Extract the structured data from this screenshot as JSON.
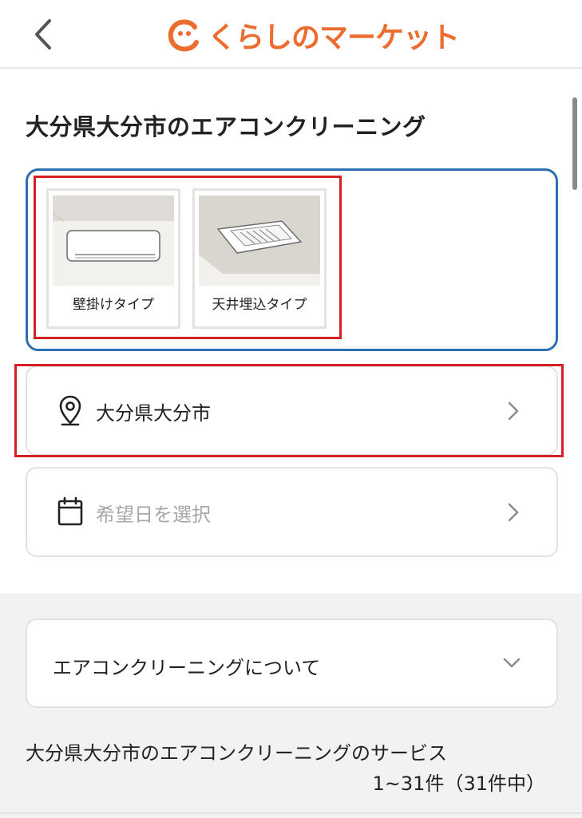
{
  "header": {
    "logo_text": "くらしのマーケット",
    "back_icon": "chevron-left-icon",
    "brand_color": "#ec6d2f"
  },
  "page": {
    "title": "大分県大分市のエアコンクリーニング"
  },
  "types": [
    {
      "label": "壁掛けタイプ",
      "icon": "wall-mounted-ac-icon"
    },
    {
      "label": "天井埋込タイプ",
      "icon": "ceiling-embedded-ac-icon"
    }
  ],
  "location": {
    "value": "大分県大分市",
    "icon": "map-pin-icon"
  },
  "date": {
    "placeholder": "希望日を選択",
    "icon": "calendar-icon"
  },
  "about": {
    "label": "エアコンクリーニングについて",
    "icon": "chevron-down-icon"
  },
  "services": {
    "title": "大分県大分市のエアコンクリーニングのサービス",
    "count": "1~31件（31件中）"
  },
  "colors": {
    "panel_border": "#2e6fb3",
    "highlight": "#d51f27",
    "placeholder_text": "#a8a8a8"
  }
}
